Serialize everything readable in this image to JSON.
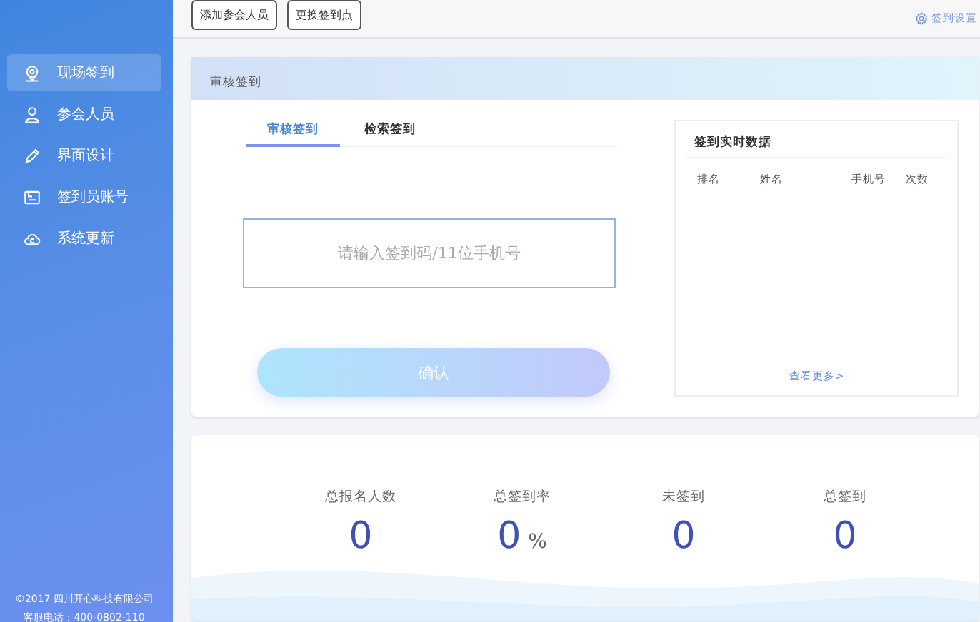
{
  "sidebar": {
    "items": [
      {
        "label": "现场签到",
        "selected": true
      },
      {
        "label": "参会人员",
        "selected": false
      },
      {
        "label": "界面设计",
        "selected": false
      },
      {
        "label": "签到员账号",
        "selected": false
      },
      {
        "label": "系统更新",
        "selected": false
      }
    ],
    "footer": [
      "©2017 四川开心科技有限公司",
      "客服电话：400-0802-110"
    ]
  },
  "toolbar": {
    "buttons": [
      "添加参会人员",
      "更换签到点"
    ],
    "settings_link": "签到设置"
  },
  "checkin_card": {
    "title": "审核签到",
    "tabs": [
      {
        "label": "审核签到",
        "selected": true
      },
      {
        "label": "检索签到",
        "selected": false
      }
    ],
    "input": {
      "placeholder": "请输入签到码/11位手机号"
    },
    "confirm_button": {
      "label": "确认",
      "disabled": true
    },
    "realtime": {
      "title": "签到实时数据",
      "columns": [
        "排名",
        "姓名",
        "手机号",
        "次数"
      ],
      "more_link": "查看更多>"
    }
  },
  "stats": [
    {
      "label": "总报名人数",
      "value": "0"
    },
    {
      "label": "总签到率",
      "value": "0",
      "unit": "%"
    },
    {
      "label": "未签到",
      "value": "0"
    },
    {
      "label": "总签到",
      "value": "0"
    }
  ]
}
